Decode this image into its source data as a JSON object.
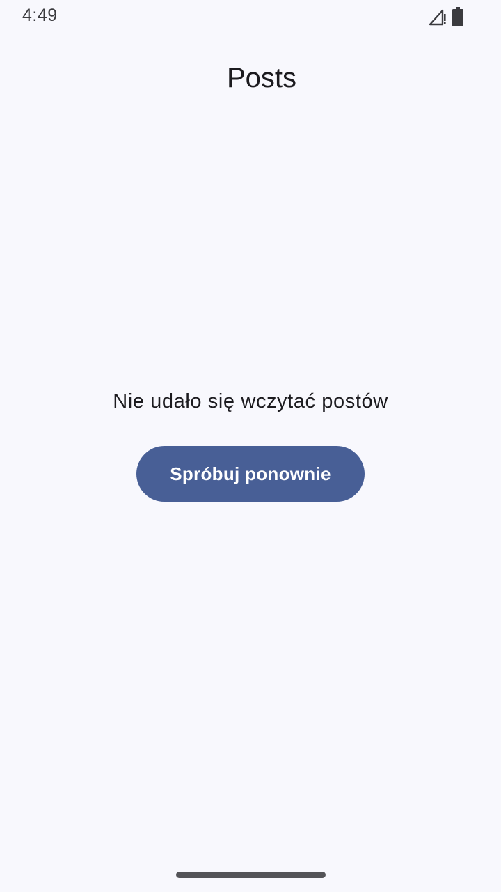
{
  "status_bar": {
    "time": "4:49",
    "icons": [
      "signal-no-data-icon",
      "battery-icon"
    ]
  },
  "header": {
    "title": "Posts"
  },
  "error_state": {
    "message": "Nie udało się wczytać postów",
    "retry_label": "Spróbuj ponownie"
  },
  "colors": {
    "background": "#f8f8fd",
    "primary": "#485f96",
    "on_primary": "#ffffff",
    "text": "#1c1b1f"
  }
}
